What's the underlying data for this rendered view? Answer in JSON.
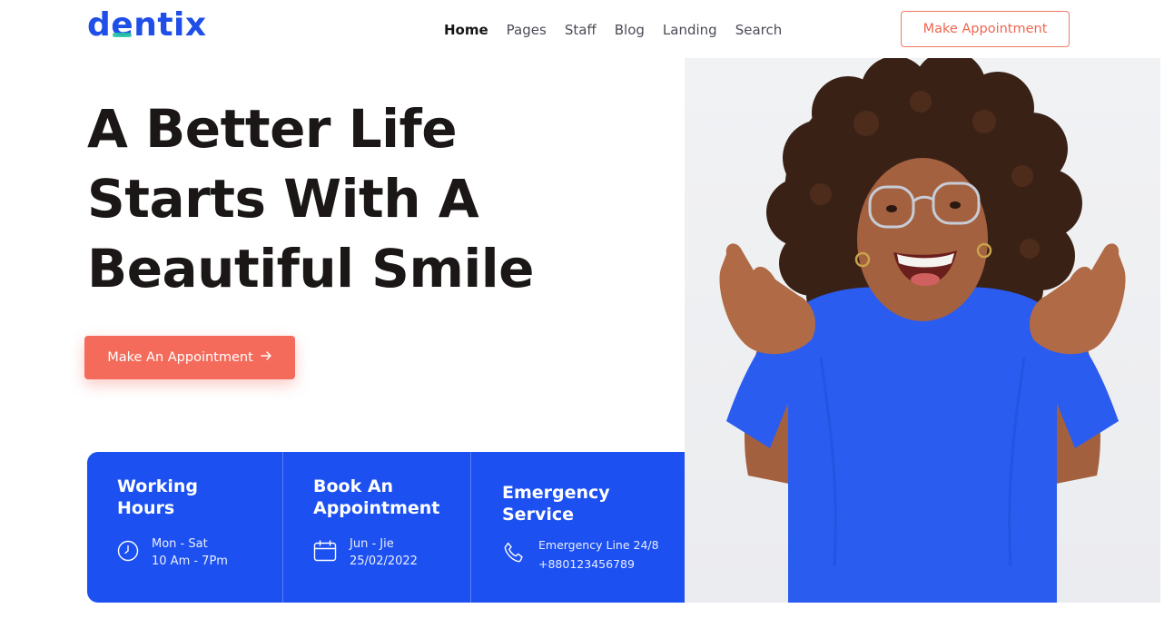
{
  "header": {
    "logo": "dentix",
    "nav": [
      "Home",
      "Pages",
      "Staff",
      "Blog",
      "Landing",
      "Search"
    ],
    "cta_label": "Make Appointment"
  },
  "hero": {
    "headline_lines": [
      "A Better Life",
      "Starts With A",
      "Beautiful Smile"
    ],
    "cta_label": "Make An Appointment",
    "cta_icon": "arrow-right-icon"
  },
  "info_cards": [
    {
      "title_lines": [
        "Working",
        "Hours"
      ],
      "icon": "clock-icon",
      "lines": [
        "Mon - Sat",
        "10 Am - 7Pm"
      ]
    },
    {
      "title_lines": [
        "Book An",
        "Appointment"
      ],
      "icon": "calendar-icon",
      "lines": [
        "Jun - Jie",
        "25/02/2022"
      ]
    },
    {
      "title_lines": [
        "Emergency",
        "Service"
      ],
      "icon": "phone-icon",
      "lines": [
        "Emergency Line 24/8",
        "+880123456789"
      ]
    }
  ],
  "colors": {
    "brand_blue": "#1f4ee8",
    "accent_coral": "#f46b5b",
    "logo_teal": "#23c4a2",
    "panel_blue": "#1c50f0"
  }
}
